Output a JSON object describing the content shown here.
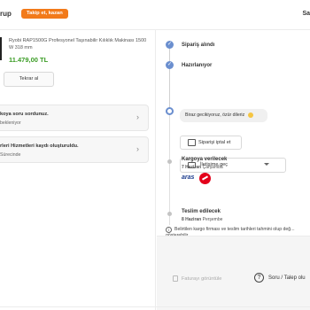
{
  "header": {
    "left_text": "rup",
    "pill": "Takip et, kazan",
    "right_text": "Sa"
  },
  "product": {
    "name": "Ryobi RAP1500G Profesyonel Taşınabilir Kılıklık Makinası 1500 W 318 mm",
    "price": "11.479,00 TL",
    "repeat_button": "Tekrar al"
  },
  "cards": [
    {
      "title": "koya soru sordunuz.",
      "subtitle": "bekleniyor"
    },
    {
      "title": "rleri Hizmetleri kaydı oluşturuldu.",
      "subtitle": "Sürecinde"
    }
  ],
  "timeline": {
    "step1": "Sipariş alındı",
    "step2": "Hazırlanıyor",
    "message": "Biraz gecikiyoruz, özür dileriz",
    "cancel_button": "Siparişi iptal et",
    "contact_button": "İletişime geç",
    "step3": "Kargoya verilecek",
    "step3_date_bold": "7 Haziran",
    "step3_date_day": "Çarşamba",
    "carrier": "aras",
    "step4": "Teslim edilecek",
    "step4_date_bold": "8 Haziran",
    "step4_date_day": "Perşembe"
  },
  "info": {
    "text": "Belirtilen kargo firması ve teslim tarihleri tahmini olup değ... gösterebilir."
  },
  "footer": {
    "invoice": "Faturayı görüntüle",
    "question": "Soru / Talep olu"
  },
  "colors": {
    "accent": "#f27a1a",
    "price": "#3a9c24",
    "timeline": "#6b8fcf"
  }
}
